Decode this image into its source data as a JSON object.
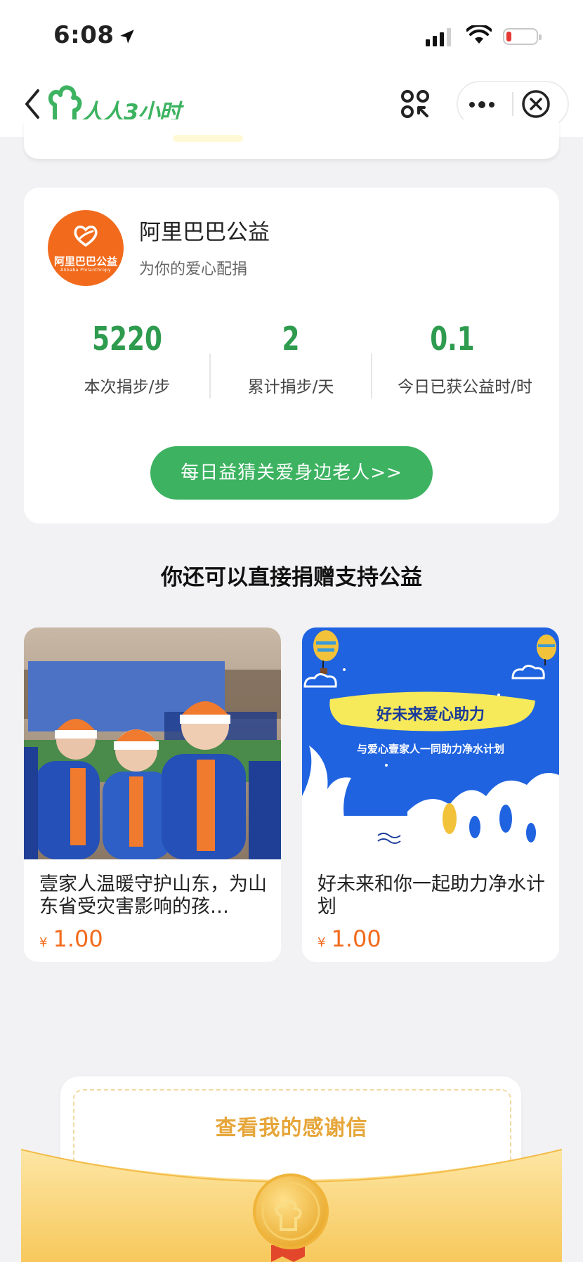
{
  "status_bar": {
    "time": "6:08"
  },
  "nav": {
    "app_name": "人人3小时"
  },
  "org": {
    "logo_cn": "阿里巴巴公益",
    "logo_en": "Alibaba Philanthropy",
    "name": "阿里巴巴公益",
    "subtitle": "为你的爱心配捐"
  },
  "stats": [
    {
      "value": "5220",
      "label": "本次捐步/步"
    },
    {
      "value": "2",
      "label": "累计捐步/天"
    },
    {
      "value": "0.1",
      "label": "今日已获公益时/时"
    }
  ],
  "cta_label": "每日益猜关爱身边老人>>",
  "section_title": "你还可以直接捐赠支持公益",
  "projects": [
    {
      "title": "壹家人温暖守护山东，为山东省受灾害影响的孩…",
      "currency": "¥",
      "price": "1.00"
    },
    {
      "title": "好未来和你一起助力净水计划",
      "currency": "¥",
      "price": "1.00",
      "poster_title": "好未来爱心助力",
      "poster_sub": "与爱心壹家人一同助力净水计划"
    }
  ],
  "thanks_letter_label": "查看我的感谢信",
  "colors": {
    "brand_green": "#3db361",
    "stat_green": "#2e9b4e",
    "price_orange": "#f26b1d",
    "letter_gold": "#e6a63a"
  }
}
